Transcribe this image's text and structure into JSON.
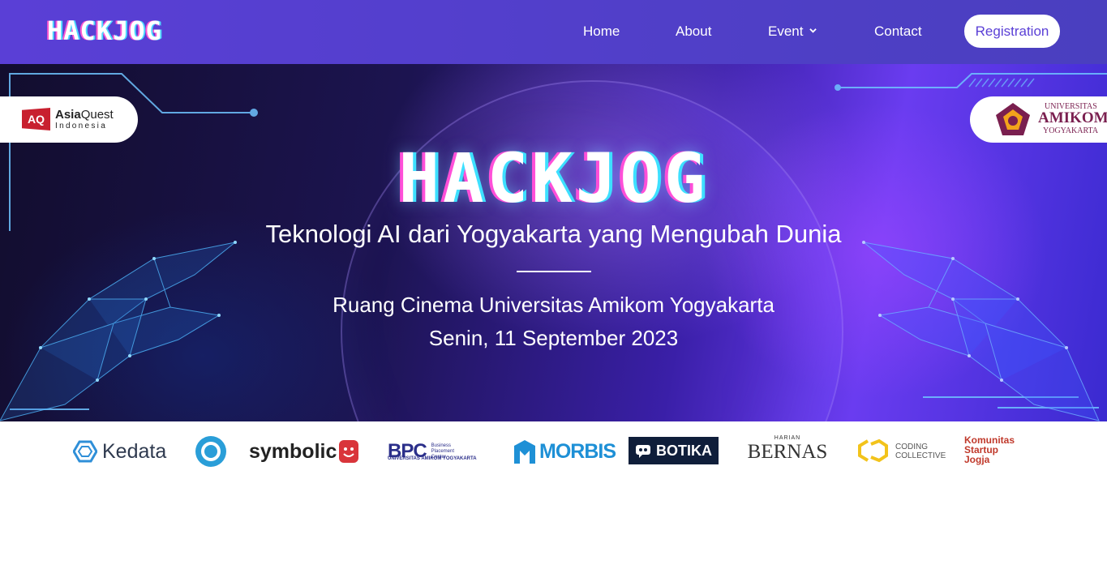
{
  "navbar": {
    "logo": "HACKJOG",
    "links": [
      {
        "label": "Home"
      },
      {
        "label": "About"
      },
      {
        "label": "Event"
      },
      {
        "label": "Contact"
      }
    ],
    "registration_label": "Registration"
  },
  "hero": {
    "title": "HACKJOG",
    "subtitle": "Teknologi AI dari Yogyakarta yang Mengubah Dunia",
    "venue": "Ruang Cinema Universitas Amikom Yogyakarta",
    "date": "Senin, 11 September 2023",
    "partner_left": {
      "mark": "AQ",
      "name_bold": "Asia",
      "name_rest": "Quest",
      "sub": "Indonesia"
    },
    "partner_right": {
      "line1": "UNIVERSITAS",
      "line2": "AMIKOM",
      "line3": "YOGYAKARTA"
    }
  },
  "sponsors": {
    "kedata": "Kedata",
    "symbolic": "symbolic",
    "bpc": {
      "main": "BPC",
      "side1": "Business",
      "side2": "Placement",
      "side3": "Center",
      "under": "UNIVERSITAS AMIKOM YOGYAKARTA"
    },
    "morbis": "MORBIS",
    "botika": "BOTIKA",
    "bernas": {
      "top": "HARIAN",
      "main": "BERNAS"
    },
    "coding": {
      "line1": "CODING",
      "line2": "COLLECTIVE"
    },
    "komunitas": {
      "line1": "Komunitas",
      "line2": "Startup",
      "line3": "Jogja"
    }
  },
  "colors": {
    "nav_bg": "#5a3fd6",
    "accent": "#5a3fd6",
    "cyan": "#3de0ff",
    "magenta": "#ff4fd8"
  }
}
